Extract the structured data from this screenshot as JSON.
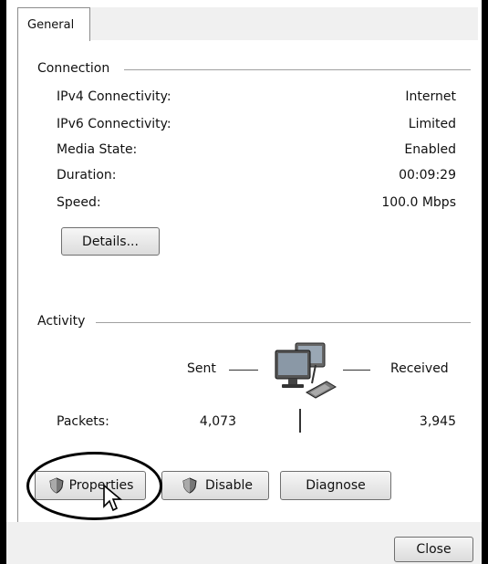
{
  "tab": {
    "label": "General"
  },
  "connection": {
    "title": "Connection",
    "rows": [
      {
        "label": "IPv4 Connectivity:",
        "value": "Internet"
      },
      {
        "label": "IPv6 Connectivity:",
        "value": "Limited"
      },
      {
        "label": "Media State:",
        "value": "Enabled"
      },
      {
        "label": "Duration:",
        "value": "00:09:29"
      },
      {
        "label": "Speed:",
        "value": "100.0 Mbps"
      }
    ],
    "details_label": "Details..."
  },
  "activity": {
    "title": "Activity",
    "sent_label": "Sent",
    "received_label": "Received",
    "packets_label": "Packets:",
    "packets_sent": "4,073",
    "packets_received": "3,945"
  },
  "buttons": {
    "properties": "Properties",
    "disable": "Disable",
    "diagnose": "Diagnose",
    "close": "Close"
  },
  "icons": {
    "shield": "uac-shield-icon",
    "network": "network-computers-icon",
    "cursor": "mouse-pointer-icon"
  }
}
